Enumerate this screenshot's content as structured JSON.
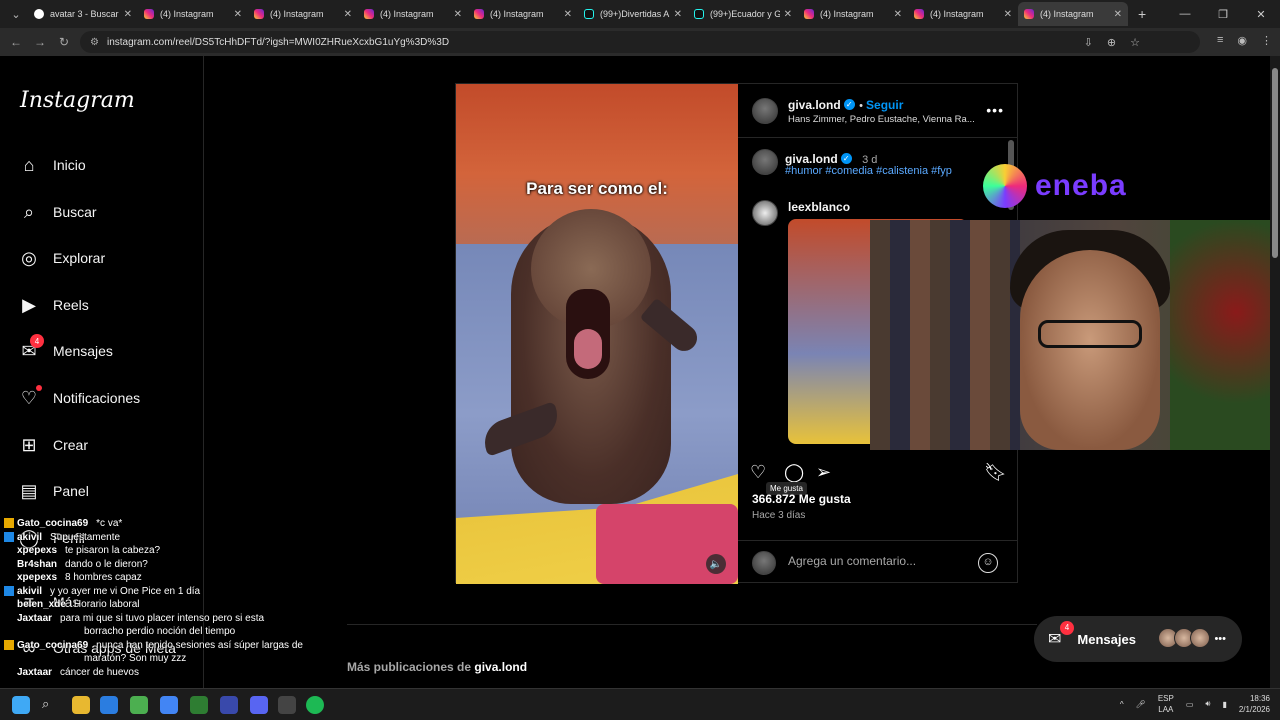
{
  "browser": {
    "tabs": [
      {
        "title": "avatar 3 - Buscar",
        "icon": "google-icon",
        "active": false
      },
      {
        "title": "(4) Instagram",
        "icon": "instagram-icon",
        "active": false
      },
      {
        "title": "(4) Instagram",
        "icon": "instagram-icon",
        "active": false
      },
      {
        "title": "(4) Instagram",
        "icon": "instagram-icon",
        "active": false
      },
      {
        "title": "(4) Instagram",
        "icon": "instagram-icon",
        "active": false
      },
      {
        "title": "(99+)Divertidas A",
        "icon": "tiktok-icon",
        "active": false
      },
      {
        "title": "(99+)Ecuador y G",
        "icon": "tiktok-icon",
        "active": false
      },
      {
        "title": "(4) Instagram",
        "icon": "instagram-icon",
        "active": false
      },
      {
        "title": "(4) Instagram",
        "icon": "instagram-icon",
        "active": false
      },
      {
        "title": "(4) Instagram",
        "icon": "instagram-icon",
        "active": true
      }
    ],
    "url": "instagram.com/reel/DS5TcHhDFTd/?igsh=MWI0ZHRueXcxbG1uYg%3D%3D"
  },
  "sidebar": {
    "logo": "Instagram",
    "items": [
      {
        "label": "Inicio",
        "icon": "home-icon"
      },
      {
        "label": "Buscar",
        "icon": "search-icon"
      },
      {
        "label": "Explorar",
        "icon": "compass-icon"
      },
      {
        "label": "Reels",
        "icon": "reels-icon"
      },
      {
        "label": "Mensajes",
        "icon": "messenger-icon",
        "badge": "4"
      },
      {
        "label": "Notificaciones",
        "icon": "heart-icon"
      },
      {
        "label": "Crear",
        "icon": "plus-square-icon"
      },
      {
        "label": "Panel",
        "icon": "dashboard-icon"
      },
      {
        "label": "Perfil",
        "icon": "profile-icon"
      },
      {
        "label": "Más",
        "icon": "menu-icon"
      },
      {
        "label": "Otras apps de Meta",
        "icon": "meta-icon"
      }
    ]
  },
  "post": {
    "video_caption": "Para ser como el:",
    "author": "giva.lond",
    "follow_label": "Seguir",
    "audio": "Hans Zimmer, Pedro Eustache, Vienna Ra...",
    "caption_time": "3 d",
    "hashtags": "#humor #comedia #calistenia #fyp",
    "commenter": "leexblanco",
    "likes": "366.872 Me gusta",
    "tooltip": "Me gusta",
    "posted": "Hace 3 días",
    "comment_placeholder": "Agrega un comentario..."
  },
  "overlay": {
    "sponsor": "eneba"
  },
  "more_posts": {
    "prefix": "Más publicaciones de",
    "user": "giva.lond"
  },
  "messages_pill": {
    "label": "Mensajes",
    "badge": "4"
  },
  "chat": [
    {
      "user": "Gato_cocina69",
      "msg": "*c va*",
      "badge": "mod"
    },
    {
      "user": "akivil",
      "msg": "Supuestamente",
      "badge": "vip"
    },
    {
      "user": "xpepexs",
      "msg": "te pisaron la cabeza?",
      "badge": "none"
    },
    {
      "user": "Br4shan",
      "msg": "dando o le dieron?",
      "badge": "none"
    },
    {
      "user": "xpepexs",
      "msg": "8 hombres capaz",
      "badge": "none"
    },
    {
      "user": "akivil",
      "msg": "y yo ayer me vi One Pice en 1 día",
      "badge": "vip"
    },
    {
      "user": "belen_xde",
      "msg": "Horario laboral",
      "badge": "none"
    },
    {
      "user": "Jaxtaar",
      "msg": "para mi que si tuvo placer intenso pero si esta",
      "badge": "none"
    },
    {
      "user": "",
      "msg": "borracho perdio noción del tiempo",
      "badge": "none"
    },
    {
      "user": "Gato_cocina69",
      "msg": "nunca han tenido sesiones así súper largas de",
      "badge": "mod"
    },
    {
      "user": "",
      "msg": "maratón? Son muy zzz",
      "badge": "none"
    },
    {
      "user": "Jaxtaar",
      "msg": "cáncer de huevos",
      "badge": "none"
    }
  ],
  "taskbar": {
    "lang": "ESP",
    "lang2": "LAA",
    "time": "18:36",
    "date": "2/1/2026"
  }
}
